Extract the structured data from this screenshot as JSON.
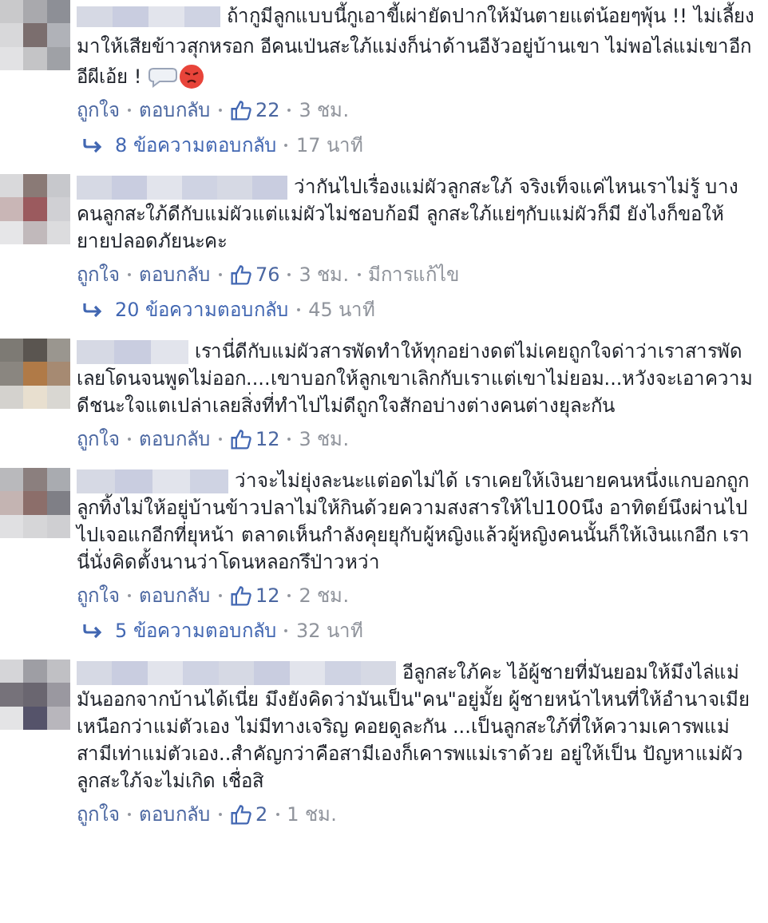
{
  "comments": [
    {
      "text": "ถ้ากูมีลูกแบบนี้กูเอาขี้เผ่ายัดปากให้มันตายแต่น้อยๆพุ้น !! ไม่เลี้ยงมาให้เสียข้าวสุกหรอก อีคนเป่นสะใภ้แม่งก็น่าด้านอีงัวอยู่บ้านเขา ไม่พอไล่แม่เขาอีก อีผีเอ้ย !",
      "emoji": true,
      "like": "ถูกใจ",
      "reply": "ตอบกลับ",
      "likes": "22",
      "time": "3 ชม.",
      "replies": {
        "count": "8 ข้อความตอบกลับ",
        "time": "17 นาที"
      }
    },
    {
      "text": "ว่ากันไปเรื่องแม่ผัวลูกสะใภ้ จริงเท็จแค่ไหนเราไม่รู้ บางคนลูกสะใภ้ดีกับแม่ผัวแต่แม่ผัวไม่ชอบก้อมี ลูกสะใภ้แย่ๆกับแม่ผัวก็มี ยังไงก็ขอให้ยายปลอดภัยนะคะ",
      "emoji": false,
      "like": "ถูกใจ",
      "reply": "ตอบกลับ",
      "likes": "76",
      "time": "3 ชม.",
      "edited": "มีการแก้ไข",
      "replies": {
        "count": "20 ข้อความตอบกลับ",
        "time": "45 นาที"
      }
    },
    {
      "text": "เรานี่ดีกับแม่ผัวสารพัดทำให้ทุกอย่างดต่ไม่เคยถูกใจด่าว่าเราสารพัดเลยโดนจนพูดไม่ออก....เขาบอกให้ลูกเขาเลิกกับเราแต่เขาไม่ยอม...หวังจะเอาความดีชนะใจแตเปล่าเลยสิ่งที่ทำไปไม่ดีถูกใจสักอบ่างต่างคนต่างยุละกัน",
      "emoji": false,
      "like": "ถูกใจ",
      "reply": "ตอบกลับ",
      "likes": "12",
      "time": "3 ชม."
    },
    {
      "text": "ว่าจะไม่ยุ่งละนะแต่อดไม่ได้ เราเคยให้เงินยายคนหนึ่งแกบอกถูกลูกทิ้งไม่ให้อยู่บ้านข้าวปลาไม่ให้กินด้วยความสงสารให้ไป100นึง อาทิตย์นึงผ่านไป ไปเจอแกอีกที่ยุหน้า ตลาดเห็นกำลังคุยยุกับผู้หญิงแล้วผู้หญิงคนนั้นก็ให้เงินแกอีก เรานี่นั่งคิดตั้งนานว่าโดนหลอกรึป่าวหว่า",
      "emoji": false,
      "like": "ถูกใจ",
      "reply": "ตอบกลับ",
      "likes": "12",
      "time": "2 ชม.",
      "replies": {
        "count": "5 ข้อความตอบกลับ",
        "time": "32 นาที"
      }
    },
    {
      "text": "อีลูกสะใภ้คะ ไอ้ผู้ชายที่มันยอมให้มึงไล่แม่มันออกจากบ้านได้เนี่ย มึงยังคิดว่ามันเป็น\"คน\"อยู่มั้ย ผู้ชายหน้าไหนที่ให้อำนาจเมียเหนือกว่าแม่ตัวเอง ไม่มีทางเจริญ คอยดูละกัน ...เป็นลูกสะใภ้ที่ให้ความเคารพแม่สามีเท่าแม่ตัวเอง..สำคัญกว่าคือสามีเองก็เคารพแม่เราด้วย อยู่ให้เป็น ปัญหาแม่ผัวลูกสะใภ้จะไม่เกิด เชื่อสิ",
      "emoji": false,
      "like": "ถูกใจ",
      "reply": "ตอบกลับ",
      "likes": "2",
      "time": "1 ชม."
    }
  ]
}
